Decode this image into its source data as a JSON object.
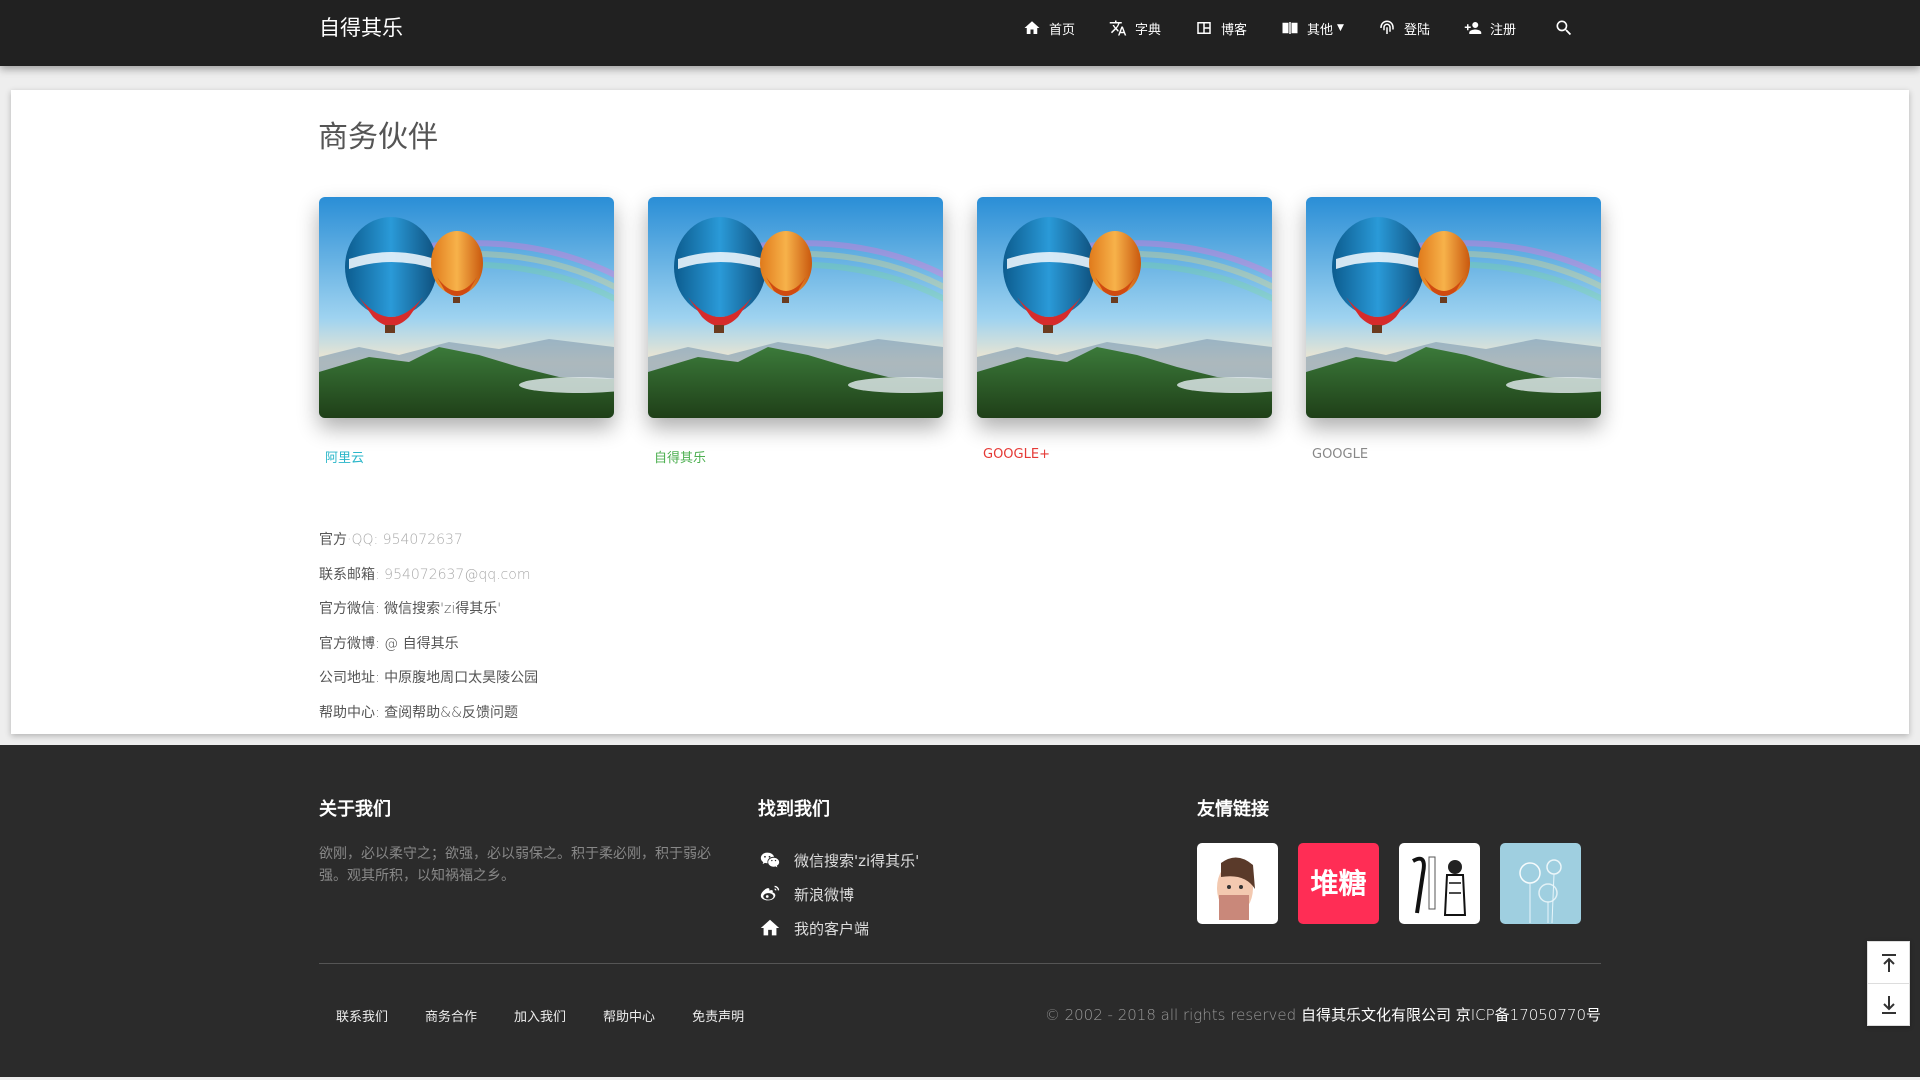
{
  "nav": {
    "brand": "自得其乐",
    "items": [
      {
        "label": "首页",
        "icon": "home-icon"
      },
      {
        "label": "字典",
        "icon": "translate-icon"
      },
      {
        "label": "博客",
        "icon": "blog-grid-icon"
      },
      {
        "label": "其他",
        "icon": "book-icon",
        "dropdown": true
      },
      {
        "label": "登陆",
        "icon": "fingerprint-icon"
      },
      {
        "label": "注册",
        "icon": "person-add-icon"
      }
    ],
    "search_icon": "search-icon"
  },
  "main": {
    "title": "商务伙伴",
    "partners": [
      {
        "name": "阿里云",
        "color": "#2ab6c9"
      },
      {
        "name": "自得其乐",
        "color": "#4caf50"
      },
      {
        "name": "GOOGLE+",
        "color": "#e53935"
      },
      {
        "name": "GOOGLE",
        "color": "#888888"
      }
    ],
    "contacts": [
      {
        "label": "官方",
        "value": "·QQ: 954072637"
      },
      {
        "label": "联系邮箱",
        "value": ": 954072637@qq.com"
      },
      {
        "label": "官方微信",
        "value": ": 微信搜索'zi得其乐'"
      },
      {
        "label": "官方微博",
        "value": ": @ 自得其乐"
      },
      {
        "label": "公司地址",
        "value": ": 中原腹地周口太昊陵公园"
      },
      {
        "label": "帮助中心",
        "value": ": 查阅帮助&&反馈问题"
      }
    ]
  },
  "footer": {
    "about_title": "关于我们",
    "about_text": "欲刚，必以柔守之；欲强，必以弱保之。积于柔必刚，积于弱必强。观其所积，以知祸福之乡。",
    "find_title": "找到我们",
    "find_items": [
      {
        "label": "微信搜索'zi得其乐'",
        "icon": "wechat-icon"
      },
      {
        "label": "新浪微博",
        "icon": "weibo-icon"
      },
      {
        "label": "我的客户端",
        "icon": "home-icon"
      }
    ],
    "links_title": "友情链接",
    "friend_links": [
      {
        "name": "cartoon-couple-thumb"
      },
      {
        "name": "duitang-logo",
        "text": "堆糖",
        "color": "#ff2d55"
      },
      {
        "name": "ink-figure-thumb"
      },
      {
        "name": "dandelion-thumb"
      }
    ],
    "bottom_nav": [
      "联系我们",
      "商务合作",
      "加入我们",
      "帮助中心",
      "免责声明"
    ],
    "copyright_prefix": "© 2002 - 2018 all rights reserved ",
    "copyright_company": "自得其乐文化有限公司 京ICP备17050770号"
  },
  "scroll": {
    "top_icon": "arrow-to-top-icon",
    "bottom_icon": "arrow-to-bottom-icon"
  }
}
